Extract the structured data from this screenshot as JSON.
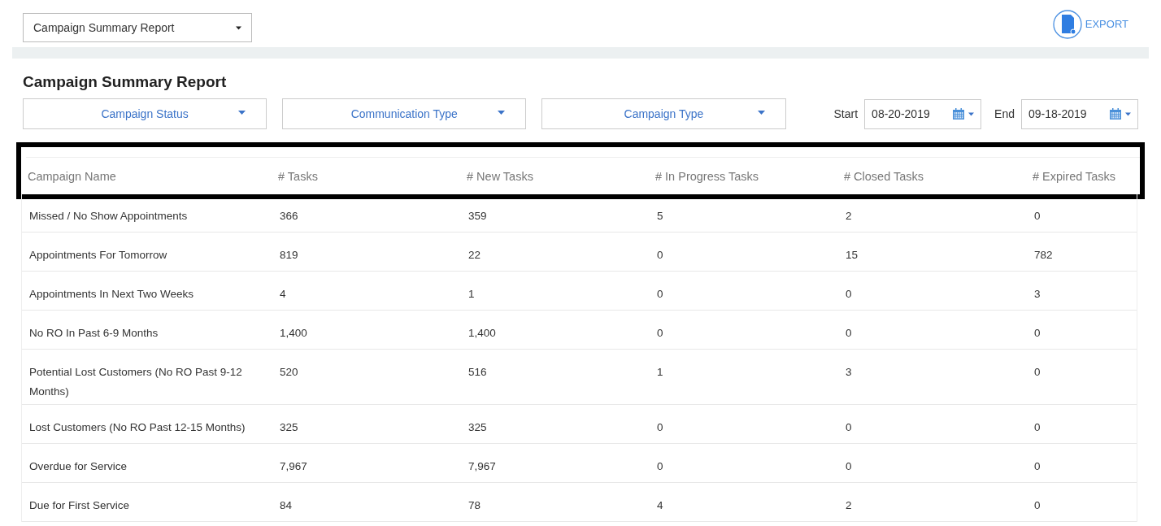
{
  "report_select": {
    "value": "Campaign Summary Report"
  },
  "export": {
    "label": "EXPORT"
  },
  "title": "Campaign Summary Report",
  "filters": [
    {
      "label": "Campaign Status"
    },
    {
      "label": "Communication Type"
    },
    {
      "label": "Campaign Type"
    }
  ],
  "date_range": {
    "start_label": "Start",
    "start_value": "08-20-2019",
    "end_label": "End",
    "end_value": "09-18-2019"
  },
  "table": {
    "columns": [
      "Campaign Name",
      "# Tasks",
      "# New Tasks",
      "# In Progress Tasks",
      "# Closed Tasks",
      "# Expired Tasks"
    ],
    "rows": [
      [
        "Missed / No Show Appointments",
        "366",
        "359",
        "5",
        "2",
        "0"
      ],
      [
        "Appointments For Tomorrow",
        "819",
        "22",
        "0",
        "15",
        "782"
      ],
      [
        "Appointments In Next Two Weeks",
        "4",
        "1",
        "0",
        "0",
        "3"
      ],
      [
        "No RO In Past 6-9 Months",
        "1,400",
        "1,400",
        "0",
        "0",
        "0"
      ],
      [
        "Potential Lost Customers (No RO Past 9-12 Months)",
        "520",
        "516",
        "1",
        "3",
        "0"
      ],
      [
        "Lost Customers (No RO Past 12-15 Months)",
        "325",
        "325",
        "0",
        "0",
        "0"
      ],
      [
        "Overdue for Service",
        "7,967",
        "7,967",
        "0",
        "0",
        "0"
      ],
      [
        "Due for First Service",
        "84",
        "78",
        "4",
        "2",
        "0"
      ]
    ]
  }
}
